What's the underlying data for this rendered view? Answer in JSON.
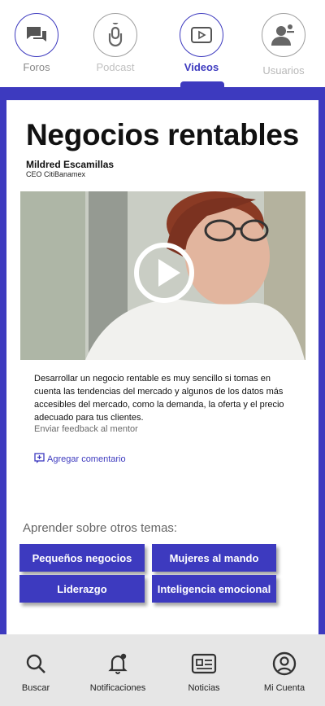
{
  "top_tabs": [
    {
      "label": "Foros",
      "icon": "forum-icon"
    },
    {
      "label": "Podcast",
      "icon": "microphone-icon"
    },
    {
      "label": "Videos",
      "icon": "video-icon"
    },
    {
      "label": "Usuarios",
      "icon": "users-icon"
    }
  ],
  "active_tab": "Videos",
  "article": {
    "title": "Negocios rentables",
    "author": "Mildred Escamillas",
    "role": "CEO CitiBanamex",
    "description": "Desarrollar un negocio rentable es muy sencillo si tomas en cuenta las tendencias del mercado y algunos de los datos más accesibles del mercado, como la demanda, la oferta y el precio adecuado para tus clientes.",
    "feedback": "Enviar feedback al mentor",
    "add_comment": "Agregar comentario"
  },
  "topics": {
    "heading": "Aprender sobre otros temas:",
    "items": [
      "Pequeños negocios",
      "Mujeres al mando",
      "Liderazgo",
      "Inteligencia emocional"
    ]
  },
  "bottom_nav": [
    {
      "label": "Buscar",
      "icon": "search-icon"
    },
    {
      "label": "Notificaciones",
      "icon": "bell-icon"
    },
    {
      "label": "Noticias",
      "icon": "news-icon"
    },
    {
      "label": "Mi Cuenta",
      "icon": "account-icon"
    }
  ],
  "colors": {
    "accent": "#3d3abf",
    "nav_bg": "#e6e6e6"
  }
}
